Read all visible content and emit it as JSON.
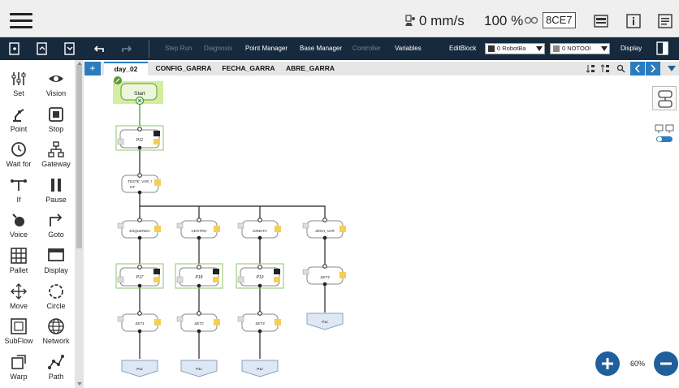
{
  "topbar": {
    "speed": "0 mm/s",
    "speed_pct": "100 %",
    "device_id": "8CE7"
  },
  "toolbar": {
    "step_run": "Step Run",
    "diagnosis": "Diagnosis",
    "point_manager": "Point Manager",
    "base_manager": "Base Manager",
    "controller": "Controller",
    "variables": "Variables",
    "edit_block": "EditBlock",
    "robot_dd": "0 RobotBa",
    "tool_dd": "0 NOTOOI",
    "display": "Display"
  },
  "sidebar": {
    "items": [
      "Set",
      "Vision",
      "Point",
      "Stop",
      "Wait for",
      "Gateway",
      "If",
      "Pause",
      "Voice",
      "Goto",
      "Pallet",
      "Display",
      "Move",
      "Circle",
      "SubFlow",
      "Network",
      "Warp",
      "Path"
    ]
  },
  "tabs": [
    "day_02",
    "CONFIG_GARRA",
    "FECHA_GARRA",
    "ABRE_GARRA"
  ],
  "flow": {
    "start": "Start",
    "n_p11": "P11",
    "n_teste": "TESTE_VAR_I",
    "n_teste2": "NT",
    "esq": "ESQUERDA",
    "centro": "CENTRO",
    "direita": "DIREITA",
    "zera": "ZERA_VAR",
    "p17": "P17",
    "p18": "P18",
    "p19": "P19",
    "set4": "SET4",
    "set1": "SET1",
    "set2": "SET2",
    "set3": "SET3",
    "end_p11": "P11"
  },
  "zoom": {
    "percent": "60%"
  },
  "colors": {
    "toolbar": "#16293d",
    "accent": "#2b7bbf",
    "zoom_btn": "#1f5f9c",
    "start_fill": "#d4eda0"
  }
}
